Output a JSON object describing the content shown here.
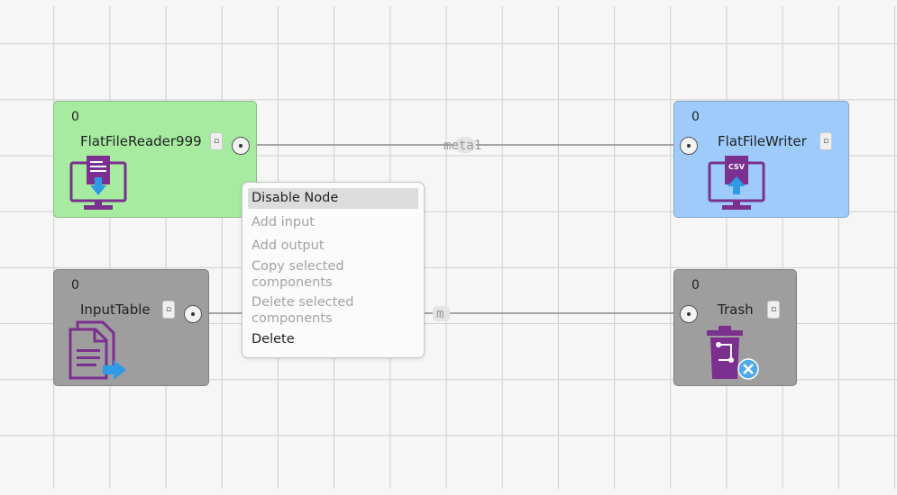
{
  "nodes": {
    "flat_file_reader": {
      "count": "0",
      "name": "FlatFileReader999",
      "menu_glyph": "▫",
      "color": "#a6eba0",
      "icon": "monitor-download-icon"
    },
    "flat_file_writer": {
      "count": "0",
      "name": "FlatFileWriter",
      "menu_glyph": "▫",
      "color": "#9ecbfb",
      "icon": "monitor-csv-upload-icon",
      "icon_text": "CSV"
    },
    "input_table": {
      "count": "0",
      "name": "InputTable",
      "menu_glyph": "▫",
      "color": "#9e9e9e",
      "icon": "document-export-icon"
    },
    "trash": {
      "count": "0",
      "name": "Trash",
      "menu_glyph": "▫",
      "color": "#9e9e9e",
      "icon": "trash-bin-icon"
    }
  },
  "edges": {
    "top_label": "meta1",
    "bottom_label": "m"
  },
  "context_menu": {
    "items": [
      {
        "label": "Disable Node",
        "enabled": true,
        "highlighted": true
      },
      {
        "label": "Add input",
        "enabled": false
      },
      {
        "label": "Add output",
        "enabled": false
      },
      {
        "label": "Copy selected components",
        "enabled": false
      },
      {
        "label": "Delete selected components",
        "enabled": false
      },
      {
        "label": "Delete",
        "enabled": true
      }
    ]
  },
  "colors": {
    "icon_purple": "#7b2f8e",
    "icon_blue": "#2f9ae6",
    "edge_gray": "#8a8a8a"
  }
}
